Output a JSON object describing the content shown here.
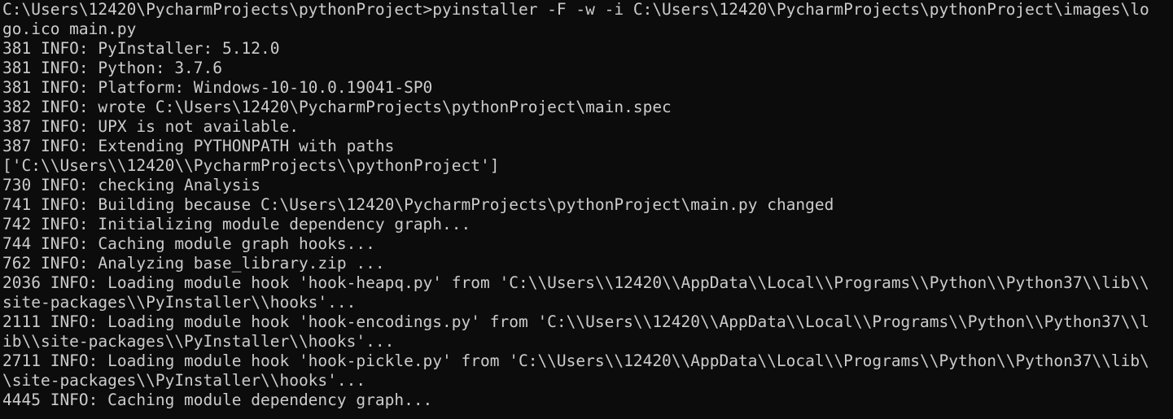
{
  "console": {
    "lines": [
      "C:\\Users\\12420\\PycharmProjects\\pythonProject>pyinstaller -F -w -i C:\\Users\\12420\\PycharmProjects\\pythonProject\\images\\lo",
      "go.ico main.py",
      "381 INFO: PyInstaller: 5.12.0",
      "381 INFO: Python: 3.7.6",
      "381 INFO: Platform: Windows-10-10.0.19041-SP0",
      "382 INFO: wrote C:\\Users\\12420\\PycharmProjects\\pythonProject\\main.spec",
      "387 INFO: UPX is not available.",
      "387 INFO: Extending PYTHONPATH with paths",
      "['C:\\\\Users\\\\12420\\\\PycharmProjects\\\\pythonProject']",
      "730 INFO: checking Analysis",
      "741 INFO: Building because C:\\Users\\12420\\PycharmProjects\\pythonProject\\main.py changed",
      "742 INFO: Initializing module dependency graph...",
      "744 INFO: Caching module graph hooks...",
      "762 INFO: Analyzing base_library.zip ...",
      "2036 INFO: Loading module hook 'hook-heapq.py' from 'C:\\\\Users\\\\12420\\\\AppData\\\\Local\\\\Programs\\\\Python\\\\Python37\\\\lib\\\\",
      "site-packages\\\\PyInstaller\\\\hooks'...",
      "2111 INFO: Loading module hook 'hook-encodings.py' from 'C:\\\\Users\\\\12420\\\\AppData\\\\Local\\\\Programs\\\\Python\\\\Python37\\\\l",
      "ib\\\\site-packages\\\\PyInstaller\\\\hooks'...",
      "2711 INFO: Loading module hook 'hook-pickle.py' from 'C:\\\\Users\\\\12420\\\\AppData\\\\Local\\\\Programs\\\\Python\\\\Python37\\\\lib\\",
      "\\site-packages\\\\PyInstaller\\\\hooks'...",
      "4445 INFO: Caching module dependency graph..."
    ]
  },
  "colors": {
    "background": "#0c0c0c",
    "foreground": "#cccccc"
  }
}
